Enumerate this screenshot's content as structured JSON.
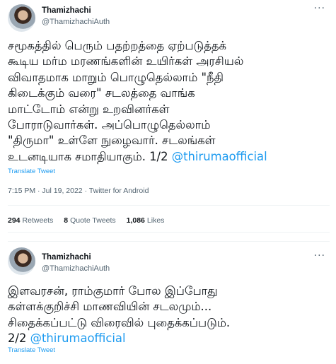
{
  "tweet1": {
    "name": "Thamizhachi",
    "handle": "@ThamizhachiAuth",
    "more": "···",
    "lines": [
      "சமூகத்தில் பெரும் பதற்றத்தை ஏற்படுத்தக்",
      "கூடிய மர்ம மரணங்களின் உயிர்கள் அரசியல்",
      "விவாதமாக மாறும் பொழுதெல்லாம் \"நீதி",
      "கிடைக்கும் வரை\" சடலத்தை வாங்க",
      "மாட்டோம் என்று உறவினர்கள்",
      "போராடுவார்கள். அப்பொழுதெல்லாம்",
      "\"திருமா\" உள்ளே நுழைவார். சடலங்கள்"
    ],
    "last_line_text": "உடனடியாக சமாதியாகும். 1/2 ",
    "mention": "@thirumaofficial",
    "translate": "Translate Tweet",
    "meta": "7:15 PM · Jul 19, 2022 · Twitter for Android",
    "stats": {
      "retweets_count": "294",
      "retweets_label": "Retweets",
      "quotes_count": "8",
      "quotes_label": "Quote Tweets",
      "likes_count": "1,086",
      "likes_label": "Likes"
    }
  },
  "tweet2": {
    "name": "Thamizhachi",
    "handle": "@ThamizhachiAuth",
    "more": "···",
    "lines": [
      "இளவரசன், ராம்குமார் போல இப்போது",
      "கள்ளக்குறிச்சி மாணவியின் சடலமும்...",
      "சிதைக்கப்பட்டு விரைவில் புதைக்கப்படும்."
    ],
    "last_line_text": "2/2 ",
    "mention": "@thirumaofficial",
    "translate": "Translate Tweet"
  },
  "colors": {
    "text": "#0f1419",
    "secondary": "#536471",
    "link": "#1d9bf0",
    "divider": "#eff3f4"
  }
}
